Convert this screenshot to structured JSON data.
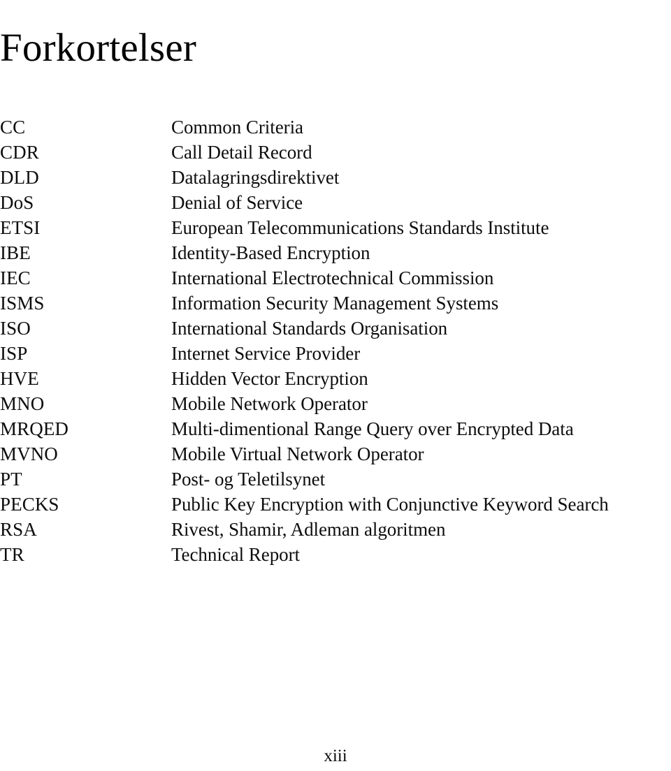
{
  "document": {
    "title": "Forkortelser",
    "page_number": "xiii"
  },
  "abbreviations": [
    {
      "term": "CC",
      "definition": "Common Criteria"
    },
    {
      "term": "CDR",
      "definition": "Call Detail Record"
    },
    {
      "term": "DLD",
      "definition": "Datalagringsdirektivet"
    },
    {
      "term": "DoS",
      "definition": "Denial of Service"
    },
    {
      "term": "ETSI",
      "definition": "European Telecommunications Standards Institute"
    },
    {
      "term": "IBE",
      "definition": "Identity-Based Encryption"
    },
    {
      "term": "IEC",
      "definition": "International Electrotechnical Commission"
    },
    {
      "term": "ISMS",
      "definition": "Information Security Management Systems"
    },
    {
      "term": "ISO",
      "definition": "International Standards Organisation"
    },
    {
      "term": "ISP",
      "definition": "Internet Service Provider"
    },
    {
      "term": "HVE",
      "definition": "Hidden Vector Encryption"
    },
    {
      "term": "MNO",
      "definition": "Mobile Network Operator"
    },
    {
      "term": "MRQED",
      "definition": "Multi-dimentional Range Query over Encrypted Data"
    },
    {
      "term": "MVNO",
      "definition": "Mobile Virtual Network Operator"
    },
    {
      "term": "PT",
      "definition": "Post- og Teletilsynet"
    },
    {
      "term": "PECKS",
      "definition": "Public Key Encryption with Conjunctive Keyword Search"
    },
    {
      "term": "RSA",
      "definition": "Rivest, Shamir, Adleman algoritmen"
    },
    {
      "term": "TR",
      "definition": "Technical Report"
    }
  ]
}
